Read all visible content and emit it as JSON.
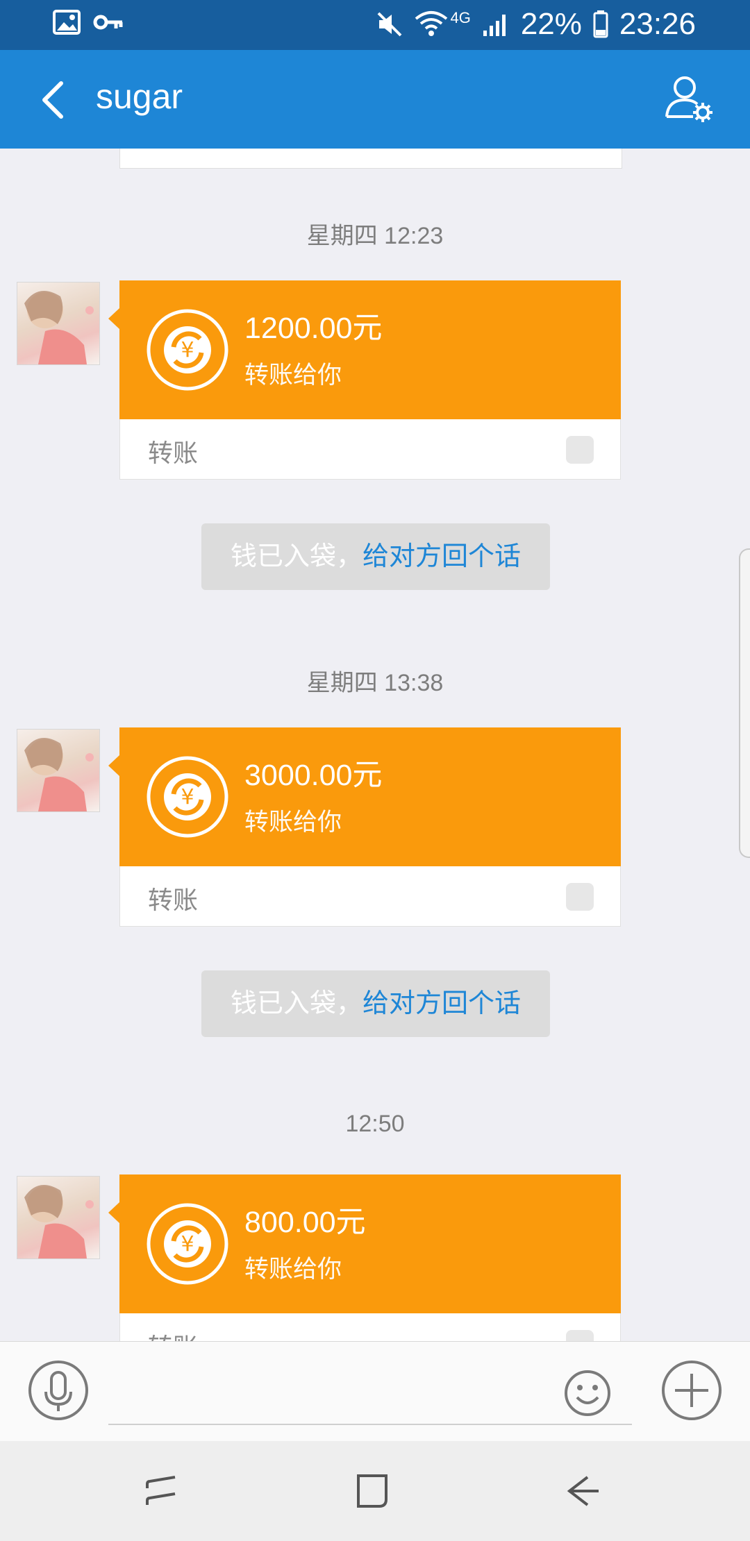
{
  "status_bar": {
    "battery": "22%",
    "time": "23:26",
    "network": "4G",
    "icons": [
      "image-icon",
      "key-icon",
      "mute-icon",
      "wifi-icon",
      "signal-icon",
      "battery-icon"
    ]
  },
  "header": {
    "title": "sugar",
    "back_icon": "back-arrow-icon",
    "profile_icon": "profile-settings-icon"
  },
  "messages": [
    {
      "timestamp": "星期四 12:23",
      "amount": "1200.00元",
      "desc": "转账给你",
      "footer_label": "转账",
      "notice_text": "钱已入袋，",
      "notice_link": "给对方回个话"
    },
    {
      "timestamp": "星期四 13:38",
      "amount": "3000.00元",
      "desc": "转账给你",
      "footer_label": "转账",
      "notice_text": "钱已入袋，",
      "notice_link": "给对方回个话"
    },
    {
      "timestamp": "12:50",
      "amount": "800.00元",
      "desc": "转账给你",
      "footer_label": "转账"
    }
  ],
  "input_bar": {
    "icons": [
      "microphone-icon",
      "emoji-icon",
      "plus-icon"
    ]
  },
  "nav_bar": {
    "icons": [
      "recent-apps-icon",
      "home-icon",
      "back-icon"
    ]
  },
  "colors": {
    "status_bar": "#175e9e",
    "header": "#1e86d6",
    "transfer_card": "#fa9a0c",
    "link": "#1e86d6",
    "background": "#efeff4"
  }
}
